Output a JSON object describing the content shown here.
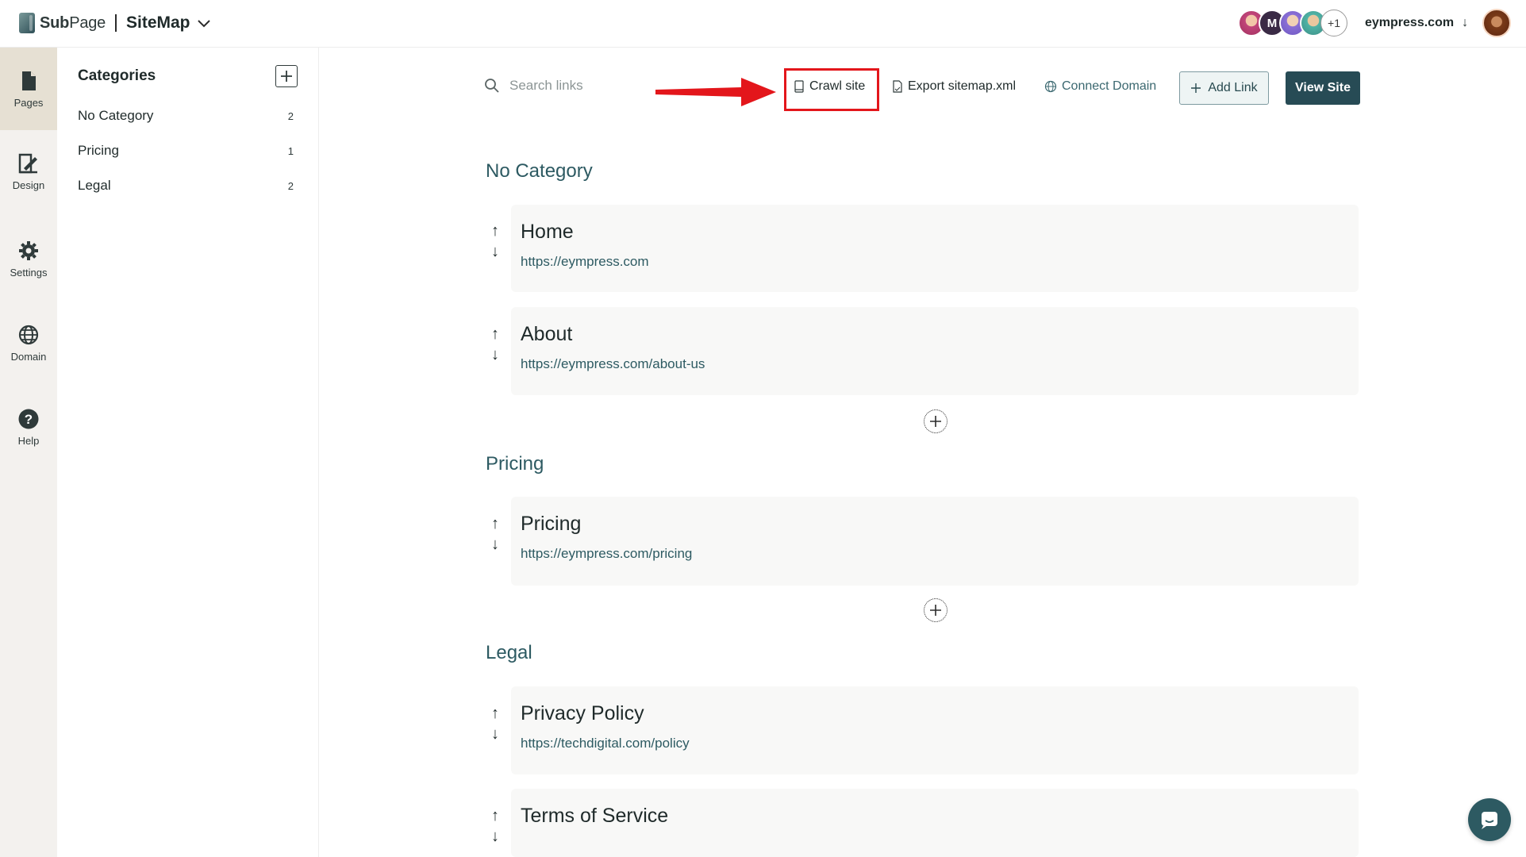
{
  "header": {
    "logo_light": "Sub",
    "logo_rest": "Page",
    "page_title": "SiteMap",
    "avatar_m": "M",
    "avatar_more": "+1",
    "domain": "eympress.com",
    "domain_arrow": "↓"
  },
  "rail": {
    "items": [
      {
        "label": "Pages",
        "icon": "pages-icon",
        "active": true
      },
      {
        "label": "Design",
        "icon": "design-icon"
      },
      {
        "label": "Settings",
        "icon": "gear-icon"
      },
      {
        "label": "Domain",
        "icon": "globe-icon"
      },
      {
        "label": "Help",
        "icon": "help-icon"
      }
    ]
  },
  "categories": {
    "title": "Categories",
    "items": [
      {
        "label": "No Category",
        "count": "2"
      },
      {
        "label": "Pricing",
        "count": "1"
      },
      {
        "label": "Legal",
        "count": "2"
      }
    ]
  },
  "toolbar": {
    "search_placeholder": "Search links",
    "crawl": "Crawl site",
    "export": "Export sitemap.xml",
    "connect": "Connect Domain",
    "add_link": "Add Link",
    "view_site": "View Site"
  },
  "sections": [
    {
      "title": "No Category",
      "links": [
        {
          "title": "Home",
          "url": "https://eympress.com"
        },
        {
          "title": "About",
          "url": "https://eympress.com/about-us"
        }
      ]
    },
    {
      "title": "Pricing",
      "links": [
        {
          "title": "Pricing",
          "url": "https://eympress.com/pricing"
        }
      ]
    },
    {
      "title": "Legal",
      "links": [
        {
          "title": "Privacy Policy",
          "url": "https://techdigital.com/policy"
        },
        {
          "title": "Terms of Service",
          "url": ""
        }
      ]
    }
  ],
  "arrows": {
    "up": "↑",
    "down": "↓"
  },
  "colors": {
    "accent": "#274b55",
    "highlight": "#e3161b",
    "link": "#2d5a62"
  }
}
